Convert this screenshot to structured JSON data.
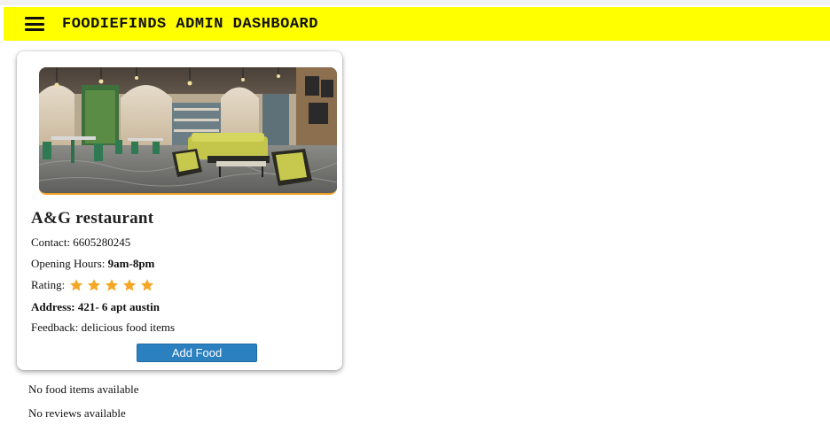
{
  "header": {
    "title": "FOODIEFINDS ADMIN DASHBOARD",
    "menu_icon": "hamburger-menu-icon",
    "background_color": "#ffff00"
  },
  "restaurant_card": {
    "image_alt": "restaurant interior",
    "name": "A&G restaurant",
    "contact_label": "Contact:",
    "contact_value": "6605280245",
    "hours_label": "Opening Hours:",
    "hours_value": "9am-8pm",
    "rating_label": "Rating:",
    "rating_stars": 5,
    "rating_max": 5,
    "star_color": "#f5a623",
    "address": "Address: 421- 6 apt austin",
    "feedback_label": "Feedback:",
    "feedback_value": "delicious food items",
    "add_food_label": "Add Food",
    "button_color": "#2b80c0"
  },
  "status": {
    "food_items": "No food items available",
    "reviews": "No reviews available"
  }
}
